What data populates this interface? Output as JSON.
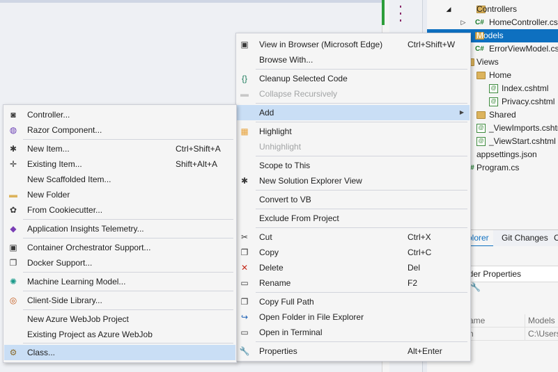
{
  "solution_explorer": {
    "items": [
      {
        "label": "Controllers",
        "type": "folder",
        "expander": "◢"
      },
      {
        "label": "HomeController.cs",
        "type": "cs",
        "expander": "▷"
      },
      {
        "label": "Models",
        "type": "folder",
        "selected": true
      },
      {
        "label": "ErrorViewModel.cs",
        "type": "cs"
      },
      {
        "label": "Views",
        "type": "folder"
      },
      {
        "label": "Home",
        "type": "folder"
      },
      {
        "label": "Index.cshtml",
        "type": "cshtml"
      },
      {
        "label": "Privacy.cshtml",
        "type": "cshtml"
      },
      {
        "label": "Shared",
        "type": "folder"
      },
      {
        "label": "_ViewImports.cshtml",
        "type": "cshtml"
      },
      {
        "label": "_ViewStart.cshtml",
        "type": "cshtml"
      },
      {
        "label": "appsettings.json",
        "type": "json"
      },
      {
        "label": "Program.cs",
        "type": "cs"
      }
    ],
    "cs_glyph": "C#",
    "cshtml_glyph": "@"
  },
  "bottom_tabs": {
    "explorer": "plorer",
    "git_changes": "Git Changes",
    "more": "C"
  },
  "properties": {
    "header": "lder Properties",
    "rows": [
      {
        "name": "ame",
        "value": "Models"
      },
      {
        "name": "h",
        "value": "C:\\Users\\"
      }
    ]
  },
  "context_menu": {
    "items": [
      {
        "label": "View in Browser (Microsoft Edge)",
        "shortcut": "Ctrl+Shift+W",
        "icon": "browser-icon"
      },
      {
        "label": "Browse With...",
        "icon": ""
      },
      {
        "label": "Cleanup Selected Code",
        "icon": "braces-icon"
      },
      {
        "label": "Collapse Recursively",
        "icon": "collapse-icon",
        "disabled": true
      },
      {
        "label": "Add",
        "icon": "",
        "submenu": true,
        "highlighted": true
      },
      {
        "label": "Highlight",
        "icon": "highlight-icon"
      },
      {
        "label": "Unhighlight",
        "icon": "",
        "disabled": true
      },
      {
        "label": "Scope to This",
        "icon": ""
      },
      {
        "label": "New Solution Explorer View",
        "icon": "new-view-icon"
      },
      {
        "label": "Convert to VB",
        "icon": ""
      },
      {
        "label": "Exclude From Project",
        "icon": ""
      },
      {
        "label": "Cut",
        "shortcut": "Ctrl+X",
        "icon": "cut-icon"
      },
      {
        "label": "Copy",
        "shortcut": "Ctrl+C",
        "icon": "copy-icon"
      },
      {
        "label": "Delete",
        "shortcut": "Del",
        "icon": "delete-icon"
      },
      {
        "label": "Rename",
        "shortcut": "F2",
        "icon": "rename-icon"
      },
      {
        "label": "Copy Full Path",
        "icon": "copy-path-icon"
      },
      {
        "label": "Open Folder in File Explorer",
        "icon": "open-folder-icon"
      },
      {
        "label": "Open in Terminal",
        "icon": "terminal-icon"
      },
      {
        "label": "Properties",
        "shortcut": "Alt+Enter",
        "icon": "wrench-icon"
      }
    ]
  },
  "add_submenu": {
    "items": [
      {
        "label": "Controller...",
        "icon": "controller-icon"
      },
      {
        "label": "Razor Component...",
        "icon": "razor-icon"
      },
      {
        "label": "New Item...",
        "shortcut": "Ctrl+Shift+A",
        "icon": "new-item-icon"
      },
      {
        "label": "Existing Item...",
        "shortcut": "Shift+Alt+A",
        "icon": "existing-item-icon"
      },
      {
        "label": "New Scaffolded Item...",
        "icon": ""
      },
      {
        "label": "New Folder",
        "icon": "folder-icon"
      },
      {
        "label": "From Cookiecutter...",
        "icon": "cookiecutter-icon"
      },
      {
        "label": "Application Insights Telemetry...",
        "icon": "insights-icon"
      },
      {
        "label": "Container Orchestrator Support...",
        "icon": "container-icon"
      },
      {
        "label": "Docker Support...",
        "icon": "docker-icon"
      },
      {
        "label": "Machine Learning Model...",
        "icon": "ml-icon"
      },
      {
        "label": "Client-Side Library...",
        "icon": "library-icon"
      },
      {
        "label": "New Azure WebJob Project",
        "icon": ""
      },
      {
        "label": "Existing Project as Azure WebJob",
        "icon": ""
      },
      {
        "label": "Class...",
        "icon": "class-icon",
        "highlighted": true
      }
    ]
  },
  "icons": {
    "browser-icon": "▣",
    "braces-icon": "{}",
    "collapse-icon": "▬",
    "highlight-icon": "▦",
    "new-view-icon": "✱",
    "cut-icon": "✂",
    "copy-icon": "❐",
    "delete-icon": "✕",
    "rename-icon": "▭",
    "copy-path-icon": "❐",
    "open-folder-icon": "↪",
    "terminal-icon": "▭",
    "wrench-icon": "🔧",
    "controller-icon": "◙",
    "razor-icon": "◍",
    "new-item-icon": "✱",
    "existing-item-icon": "✛",
    "folder-icon": "▬",
    "cookiecutter-icon": "✿",
    "insights-icon": "◆",
    "container-icon": "▣",
    "docker-icon": "❐",
    "ml-icon": "✺",
    "library-icon": "◎",
    "class-icon": "⚙"
  },
  "colors": {
    "accent": "#0e70c0",
    "menu_highlight": "#c9def5",
    "icon_colors": {
      "braces-icon": "#1a7a5a",
      "delete-icon": "#c42b1c",
      "open-folder-icon": "#1a5fb4",
      "razor-icon": "#6a3fb5",
      "insights-icon": "#7a3fb5",
      "ml-icon": "#1a9a8a",
      "library-icon": "#c45a1c",
      "folder-icon": "#dcb35c",
      "highlight-icon": "#e8a23a",
      "class-icon": "#8a6a2a",
      "collapse-icon": "#c8c8c8"
    }
  }
}
